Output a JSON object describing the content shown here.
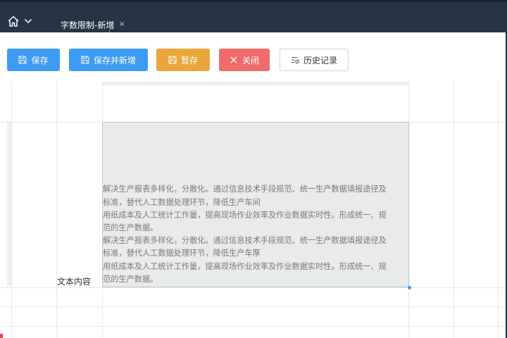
{
  "tabs": [
    {
      "label": "字数限制-新增",
      "close_glyph": "×"
    }
  ],
  "toolbar": {
    "save_label": "保存",
    "save_new_label": "保存并新增",
    "draft_label": "暂存",
    "close_label": "关闭",
    "history_label": "历史记录"
  },
  "form": {
    "field_label": "文本内容",
    "lines": [
      "解决生产报表多样化，分散化。通过信息技术手段规范、统一生产数据填报途径及",
      "标准，替代人工数据处理环节，降低生产车间",
      "用纸成本及人工统计工作量，提高现场作业效率及作业数据实时性。形成统一、规",
      "范的生产数据。",
      "解决生产报表多样化，分散化。通过信息技术手段规范、统一生产数据填报途径及",
      "标准，替代人工数据处理环节，降低生产车厚",
      "用纸成本及人工统计工作量，提高现场作业效率及作业数据实时性。形成统一、规",
      "范的生产数据。"
    ]
  },
  "colors": {
    "topbar": "#263445",
    "primary": "#3d9bf3",
    "warning": "#e9a73b",
    "danger": "#f06c6c"
  },
  "icons": {
    "home": "home-icon",
    "chevron": "chevron-down-icon",
    "save": "floppy-icon",
    "close": "x-icon",
    "history": "history-list-icon"
  }
}
